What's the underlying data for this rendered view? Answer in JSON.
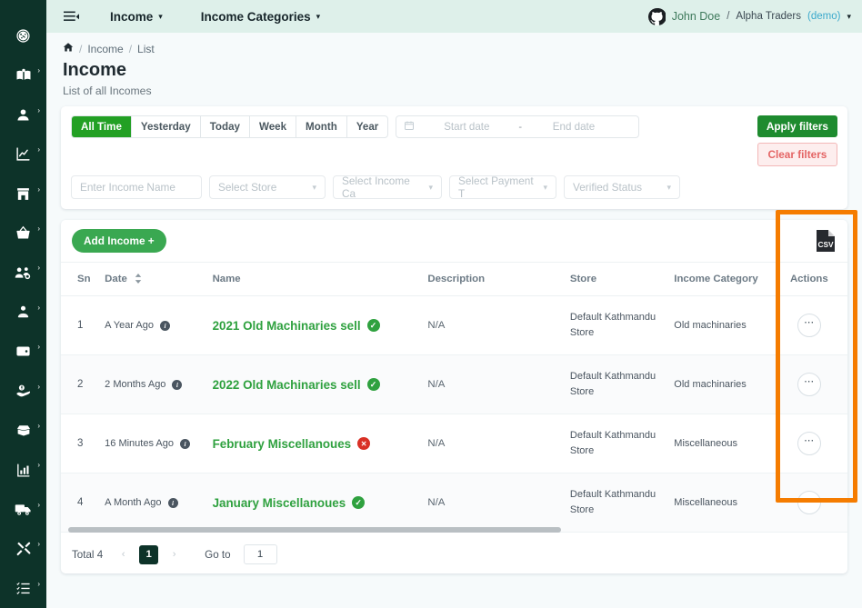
{
  "sidebar": {
    "items": [
      {
        "name": "dashboard-icon",
        "label": "Dashboard",
        "caret": false
      },
      {
        "name": "book-icon",
        "label": "Catalog",
        "caret": true
      },
      {
        "name": "user-icon",
        "label": "Users",
        "caret": true
      },
      {
        "name": "chart-line-icon",
        "label": "Reports",
        "caret": true
      },
      {
        "name": "store-icon",
        "label": "Stores",
        "caret": true
      },
      {
        "name": "basket-icon",
        "label": "Sales",
        "caret": true
      },
      {
        "name": "users-gear-icon",
        "label": "Customers",
        "caret": true
      },
      {
        "name": "people-group-icon",
        "label": "Staff",
        "caret": true
      },
      {
        "name": "wallet-icon",
        "label": "Wallet",
        "caret": true
      },
      {
        "name": "hand-dollar-icon",
        "label": "Income",
        "caret": true
      },
      {
        "name": "box-open-icon",
        "label": "Inventory",
        "caret": true
      },
      {
        "name": "bar-chart-icon",
        "label": "Statistics",
        "caret": true
      },
      {
        "name": "truck-icon",
        "label": "Delivery",
        "caret": true
      },
      {
        "name": "tools-icon",
        "label": "Settings",
        "caret": true
      },
      {
        "name": "list-check-icon",
        "label": "Tasks",
        "caret": true
      }
    ]
  },
  "topbar": {
    "menu_icon": "hamburger-icon",
    "nav1": "Income",
    "nav2": "Income Categories",
    "user": {
      "avatar_icon": "github-avatar-icon",
      "name": "John Doe",
      "separator": "/",
      "org": "Alpha Traders",
      "mode": "(demo)"
    }
  },
  "breadcrumb": {
    "home_icon": "home-icon",
    "sep": "/",
    "item1": "Income",
    "item2": "List"
  },
  "header": {
    "title": "Income",
    "subtitle": "List of all Incomes"
  },
  "filters": {
    "ranges": [
      {
        "label": "All Time",
        "active": true
      },
      {
        "label": "Yesterday",
        "active": false
      },
      {
        "label": "Today",
        "active": false
      },
      {
        "label": "Week",
        "active": false
      },
      {
        "label": "Month",
        "active": false
      },
      {
        "label": "Year",
        "active": false
      }
    ],
    "calendar_icon": "calendar-icon",
    "start_date_placeholder": "Start date",
    "date_dash": "-",
    "end_date_placeholder": "End date",
    "apply_label": "Apply filters",
    "clear_label": "Clear filters",
    "name_placeholder": "Enter Income Name",
    "store_placeholder": "Select Store",
    "category_placeholder": "Select Income Ca",
    "payment_placeholder": "Select Payment T",
    "verified_placeholder": "Verified Status"
  },
  "toolbar": {
    "add_label": "Add Income +",
    "export_icon": "csv-file-icon",
    "export_label": "CSV"
  },
  "table": {
    "columns": {
      "sn": "Sn",
      "date": "Date",
      "name": "Name",
      "description": "Description",
      "store": "Store",
      "category": "Income Category",
      "actions": "Actions"
    },
    "sort_icon": "sort-icon",
    "rows": [
      {
        "sn": "1",
        "date": "A Year Ago",
        "name": "2021 Old Machinaries sell",
        "verified": true,
        "description": "N/A",
        "store": "Default Kathmandu Store",
        "category": "Old machinaries",
        "action_icon": "ellipsis-icon"
      },
      {
        "sn": "2",
        "date": "2 Months Ago",
        "name": "2022 Old Machinaries sell",
        "verified": true,
        "description": "N/A",
        "store": "Default Kathmandu Store",
        "category": "Old machinaries",
        "action_icon": "ellipsis-icon"
      },
      {
        "sn": "3",
        "date": "16 Minutes Ago",
        "name": "February Miscellanoues",
        "verified": false,
        "description": "N/A",
        "store": "Default Kathmandu Store",
        "category": "Miscellaneous",
        "action_icon": "ellipsis-icon"
      },
      {
        "sn": "4",
        "date": "A Month Ago",
        "name": "January Miscellanoues",
        "verified": true,
        "description": "N/A",
        "store": "Default Kathmandu Store",
        "category": "Miscellaneous",
        "action_icon": "ellipsis-icon"
      }
    ]
  },
  "pagination": {
    "total": "Total 4",
    "prev": "‹",
    "page": "1",
    "next": "›",
    "goto_label": "Go to",
    "goto_value": "1"
  },
  "annotation": {
    "highlight_color": "#f57c00",
    "highlight_target": "actions-column"
  },
  "colors": {
    "sidebar": "#0d3329",
    "topbar": "#def0ea",
    "accent_green": "#23a024",
    "link_green": "#2fa13f",
    "danger_red": "#d93025"
  }
}
